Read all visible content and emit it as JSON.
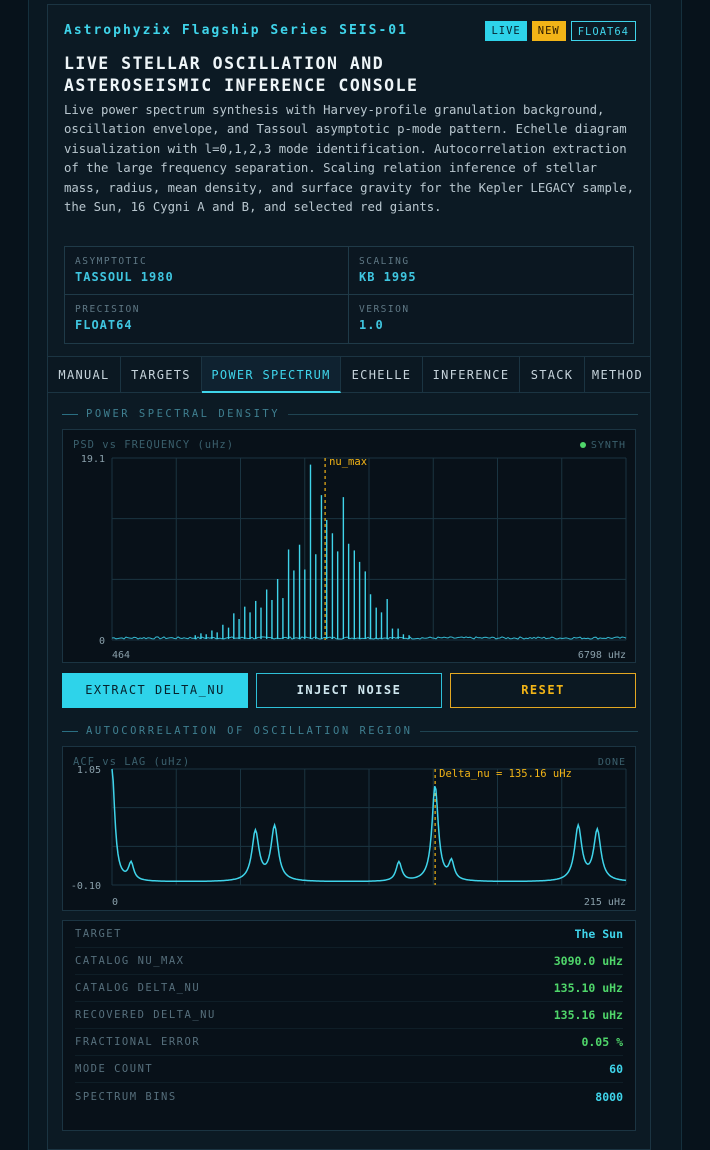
{
  "header": {
    "series": "Astrophyzix Flagship Series SEIS-01",
    "badges": {
      "live": "LIVE",
      "new": "NEW",
      "precision": "FLOAT64"
    },
    "title_line1": "LIVE STELLAR OSCILLATION AND",
    "title_line2": "ASTEROSEISMIC INFERENCE CONSOLE",
    "description": "Live power spectrum synthesis with Harvey-profile granulation background, oscillation envelope, and Tassoul asymptotic p-mode pattern. Echelle diagram visualization with l=0,1,2,3 mode identification. Autocorrelation extraction of the large frequency separation. Scaling relation inference of stellar mass, radius, mean density, and surface gravity for the Kepler LEGACY sample, the Sun, 16 Cygni A and B, and selected red giants."
  },
  "meta": [
    {
      "label": "ASYMPTOTIC",
      "value": "TASSOUL 1980"
    },
    {
      "label": "SCALING",
      "value": "KB 1995"
    },
    {
      "label": "PRECISION",
      "value": "FLOAT64"
    },
    {
      "label": "VERSION",
      "value": "1.0"
    }
  ],
  "tabs": [
    {
      "label": "MANUAL",
      "active": false
    },
    {
      "label": "TARGETS",
      "active": false
    },
    {
      "label": "POWER SPECTRUM",
      "active": true
    },
    {
      "label": "ECHELLE",
      "active": false
    },
    {
      "label": "INFERENCE",
      "active": false
    },
    {
      "label": "STACK",
      "active": false
    },
    {
      "label": "METHOD",
      "active": false
    }
  ],
  "psd_section": "POWER SPECTRAL DENSITY",
  "acf_section": "AUTOCORRELATION OF OSCILLATION REGION",
  "buttons": {
    "extract": "EXTRACT DELTA_NU",
    "inject": "INJECT NOISE",
    "reset": "RESET"
  },
  "colors": {
    "accent": "#2ed3ea",
    "warning": "#f2b417",
    "green": "#4fd66a",
    "bg": "#0c1a24"
  },
  "chart_data": [
    {
      "type": "line",
      "title": "PSD vs FREQUENCY (uHz)",
      "status": "SYNTH",
      "ylim": [
        0,
        19.1
      ],
      "ytick_labels": [
        "19.1",
        "0"
      ],
      "xlim": [
        464,
        6798
      ],
      "xtick_labels": [
        "464",
        "6798 uHz"
      ],
      "marker": {
        "label": "nu_max",
        "x": 3090
      },
      "baseline": 0.1,
      "peaks": [
        {
          "x": 1490,
          "y": 0.5
        },
        {
          "x": 1560,
          "y": 0.7
        },
        {
          "x": 1625,
          "y": 0.6
        },
        {
          "x": 1695,
          "y": 1.0
        },
        {
          "x": 1760,
          "y": 0.8
        },
        {
          "x": 1830,
          "y": 1.6
        },
        {
          "x": 1900,
          "y": 1.3
        },
        {
          "x": 1965,
          "y": 2.8
        },
        {
          "x": 2030,
          "y": 2.2
        },
        {
          "x": 2100,
          "y": 3.5
        },
        {
          "x": 2165,
          "y": 2.9
        },
        {
          "x": 2235,
          "y": 4.1
        },
        {
          "x": 2300,
          "y": 3.4
        },
        {
          "x": 2370,
          "y": 5.3
        },
        {
          "x": 2435,
          "y": 4.2
        },
        {
          "x": 2505,
          "y": 6.4
        },
        {
          "x": 2570,
          "y": 4.4
        },
        {
          "x": 2640,
          "y": 9.5
        },
        {
          "x": 2705,
          "y": 7.3
        },
        {
          "x": 2775,
          "y": 10.0
        },
        {
          "x": 2840,
          "y": 7.4
        },
        {
          "x": 2910,
          "y": 18.4
        },
        {
          "x": 2975,
          "y": 9.0
        },
        {
          "x": 3045,
          "y": 15.2
        },
        {
          "x": 3110,
          "y": 12.6
        },
        {
          "x": 3180,
          "y": 11.2
        },
        {
          "x": 3245,
          "y": 9.3
        },
        {
          "x": 3315,
          "y": 15.0
        },
        {
          "x": 3380,
          "y": 10.1
        },
        {
          "x": 3450,
          "y": 9.4
        },
        {
          "x": 3515,
          "y": 8.2
        },
        {
          "x": 3585,
          "y": 7.2
        },
        {
          "x": 3650,
          "y": 4.8
        },
        {
          "x": 3720,
          "y": 3.4
        },
        {
          "x": 3785,
          "y": 2.9
        },
        {
          "x": 3855,
          "y": 4.3
        },
        {
          "x": 3920,
          "y": 1.2
        },
        {
          "x": 3990,
          "y": 1.2
        },
        {
          "x": 4055,
          "y": 0.6
        },
        {
          "x": 4125,
          "y": 0.5
        }
      ]
    },
    {
      "type": "line",
      "title": "ACF vs LAG (uHz)",
      "status": "DONE",
      "ylim": [
        -0.1,
        1.05
      ],
      "ytick_labels": [
        "1.05",
        "-0.10"
      ],
      "xlim": [
        0,
        215
      ],
      "xtick_labels": [
        "0",
        "215 uHz"
      ],
      "marker": {
        "label": "Delta_nu = 135.16 uHz",
        "x": 135.16
      },
      "baseline": -0.07,
      "lobes": [
        {
          "x": 0,
          "y": 1.05,
          "w": 1.4
        },
        {
          "x": 8,
          "y": 0.1,
          "w": 1.3
        },
        {
          "x": 60,
          "y": 0.42,
          "w": 1.8
        },
        {
          "x": 68,
          "y": 0.47,
          "w": 1.8
        },
        {
          "x": 120,
          "y": 0.12,
          "w": 1.4
        },
        {
          "x": 135.16,
          "y": 0.88,
          "w": 1.6
        },
        {
          "x": 142,
          "y": 0.11,
          "w": 1.3
        },
        {
          "x": 195,
          "y": 0.47,
          "w": 1.8
        },
        {
          "x": 203,
          "y": 0.43,
          "w": 1.8
        }
      ]
    }
  ],
  "stats": [
    {
      "label": "TARGET",
      "value": "The Sun",
      "color": "#3fd4ea"
    },
    {
      "label": "CATALOG NU_MAX",
      "value": "3090.0 uHz",
      "color": "#4fd66a"
    },
    {
      "label": "CATALOG DELTA_NU",
      "value": "135.10 uHz",
      "color": "#4fd66a"
    },
    {
      "label": "RECOVERED DELTA_NU",
      "value": "135.16 uHz",
      "color": "#4fd66a"
    },
    {
      "label": "FRACTIONAL ERROR",
      "value": "0.05 %",
      "color": "#4fd66a"
    },
    {
      "label": "MODE COUNT",
      "value": "60",
      "color": "#3fd4ea"
    },
    {
      "label": "SPECTRUM BINS",
      "value": "8000",
      "color": "#3fd4ea"
    }
  ]
}
